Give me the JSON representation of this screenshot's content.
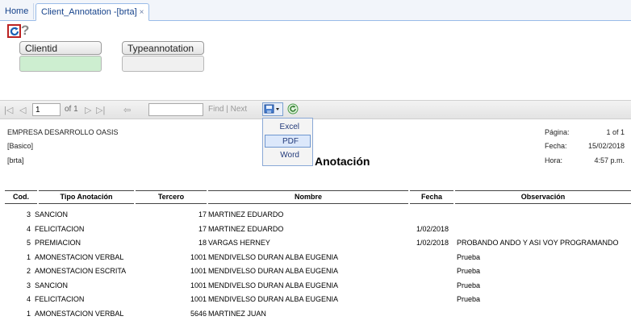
{
  "tabs": {
    "home": "Home",
    "active": "Client_Annotation -[brta]",
    "close_glyph": "×"
  },
  "params": {
    "clientid_label": "Clientid",
    "typeannotation_label": "Typeannotation",
    "clientid_color": "#cdeed0",
    "typeannotation_color": "#f0f0f0"
  },
  "toolbar": {
    "page_value": "1",
    "of_text": "of 1",
    "find_text": "Find | Next"
  },
  "export_menu": {
    "items": [
      "Excel",
      "PDF",
      "Word"
    ],
    "selected": "PDF"
  },
  "report": {
    "company": "EMPRESA DESARROLLO OASIS",
    "subtitle1": "[Basico]",
    "subtitle2": "[brta]",
    "title": "Anotación",
    "pagina_label": "Página:",
    "pagina_value": "1 of 1",
    "fecha_label": "Fecha:",
    "fecha_value": "15/02/2018",
    "hora_label": "Hora:",
    "hora_value": "4:57 p.m.",
    "columns": [
      "Cod.",
      "Tipo Anotación",
      "Tercero",
      "Nombre",
      "Fecha",
      "Observación"
    ],
    "rows": [
      {
        "cod": "3",
        "tipo": "SANCION",
        "tercero": "17",
        "nombre": "MARTINEZ  EDUARDO",
        "fecha": "",
        "obs": ""
      },
      {
        "cod": "4",
        "tipo": "FELICITACION",
        "tercero": "17",
        "nombre": "MARTINEZ  EDUARDO",
        "fecha": "1/02/2018",
        "obs": ""
      },
      {
        "cod": "5",
        "tipo": "PREMIACION",
        "tercero": "18",
        "nombre": "VARGAS HERNEY",
        "fecha": "1/02/2018",
        "obs": "PROBANDO ANDO Y ASI VOY PROGRAMANDO"
      },
      {
        "cod": "1",
        "tipo": "AMONESTACION VERBAL",
        "tercero": "1001",
        "nombre": "MENDIVELSO DURAN ALBA EUGENIA",
        "fecha": "",
        "obs": "Prueba"
      },
      {
        "cod": "2",
        "tipo": "AMONESTACION ESCRITA",
        "tercero": "1001",
        "nombre": "MENDIVELSO DURAN ALBA EUGENIA",
        "fecha": "",
        "obs": "Prueba"
      },
      {
        "cod": "3",
        "tipo": "SANCION",
        "tercero": "1001",
        "nombre": "MENDIVELSO DURAN ALBA EUGENIA",
        "fecha": "",
        "obs": "Prueba"
      },
      {
        "cod": "4",
        "tipo": "FELICITACION",
        "tercero": "1001",
        "nombre": "MENDIVELSO DURAN ALBA EUGENIA",
        "fecha": "",
        "obs": "Prueba"
      },
      {
        "cod": "1",
        "tipo": "AMONESTACION VERBAL",
        "tercero": "5646",
        "nombre": "MARTINEZ  JUAN",
        "fecha": "",
        "obs": ""
      }
    ]
  }
}
